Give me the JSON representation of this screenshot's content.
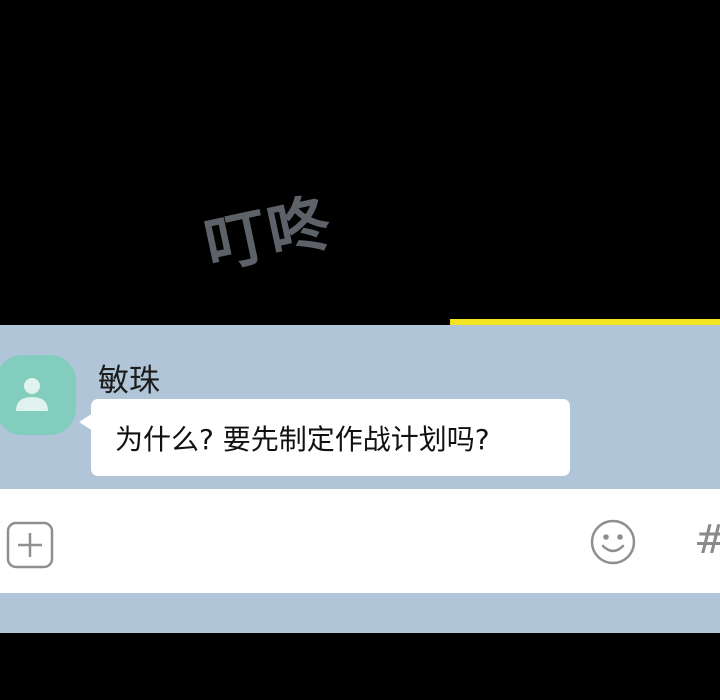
{
  "sound_effect": "叮咚",
  "message": {
    "sender": "敏珠",
    "text": "为什么? 要先制定作战计划吗?"
  },
  "input_bar": {
    "icons": [
      "plus-icon",
      "emoji-icon",
      "hash-icon"
    ],
    "hash_symbol": "#"
  },
  "colors": {
    "chat_background": "#b0c6d8",
    "avatar": "#82cdbd",
    "accent_bar": "#f2e422",
    "bubble": "#ffffff"
  }
}
